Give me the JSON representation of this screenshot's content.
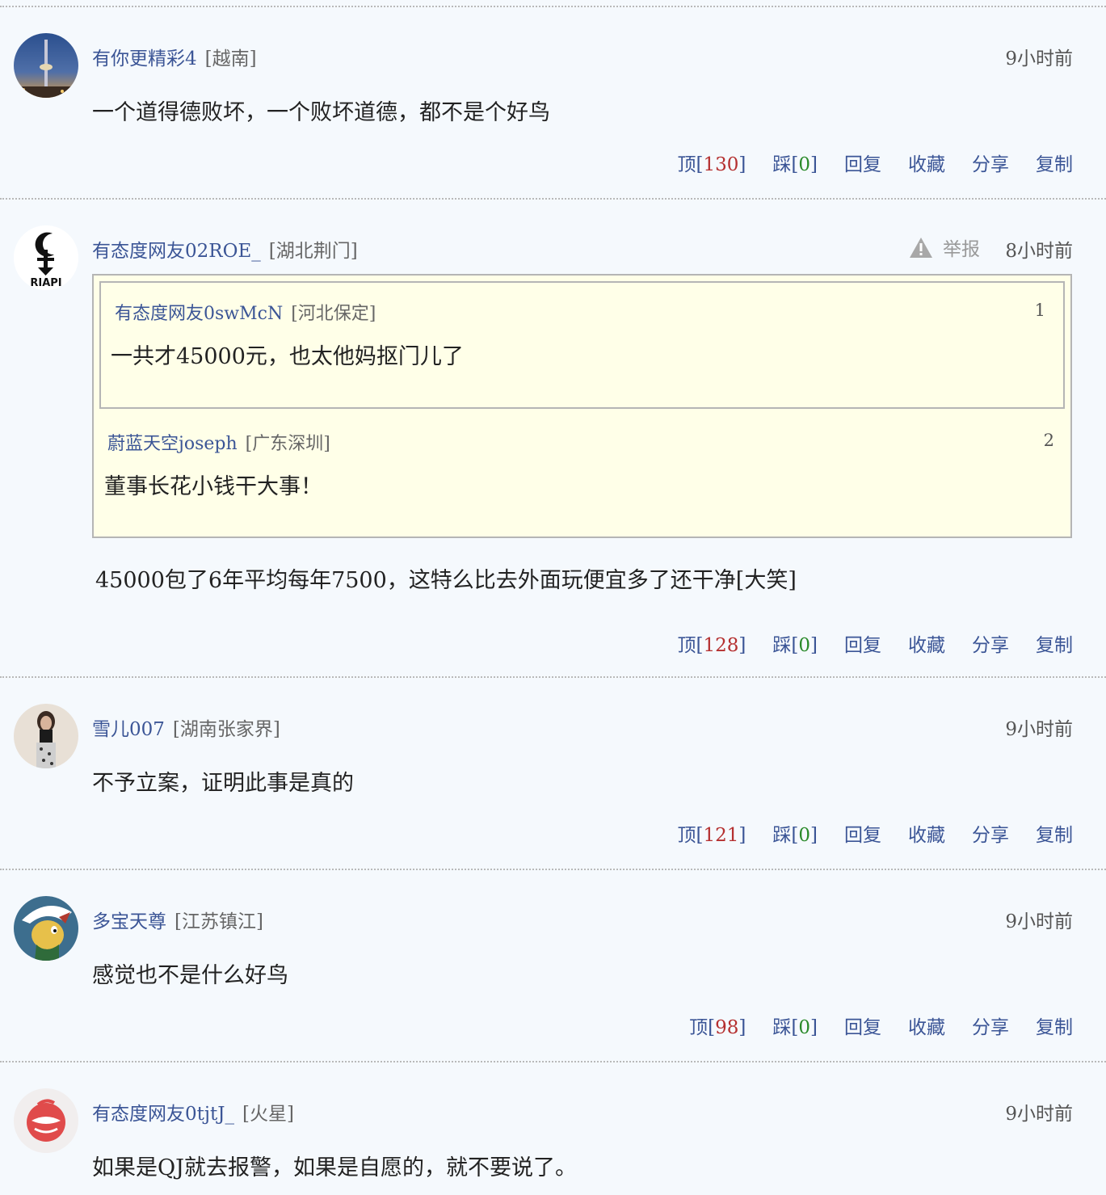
{
  "comments": [
    {
      "user": "有你更精彩4",
      "location": "[越南]",
      "time": "9小时前",
      "text": "一个道得德败坏，一个败坏道德，都不是个好鸟",
      "up_label": "顶",
      "up_count": "130",
      "down_label": "踩",
      "down_count": "0",
      "reply": "回复",
      "collect": "收藏",
      "share": "分享",
      "copy": "复制"
    },
    {
      "user": "有态度网友02ROE_",
      "location": "[湖北荆门]",
      "report": "举报",
      "time": "8小时前",
      "quotes": [
        {
          "user": "有态度网友0swMcN",
          "location": "[河北保定]",
          "floor": "1",
          "text": "一共才45000元，也太他妈抠门儿了"
        },
        {
          "user": "蔚蓝天空joseph",
          "location": "[广东深圳]",
          "floor": "2",
          "text": "董事长花小钱干大事！"
        }
      ],
      "text": "45000包了6年平均每年7500，这特么比去外面玩便宜多了还干净[大笑]",
      "up_label": "顶",
      "up_count": "128",
      "down_label": "踩",
      "down_count": "0",
      "reply": "回复",
      "collect": "收藏",
      "share": "分享",
      "copy": "复制"
    },
    {
      "user": "雪儿007",
      "location": "[湖南张家界]",
      "time": "9小时前",
      "text": "不予立案，证明此事是真的",
      "up_label": "顶",
      "up_count": "121",
      "down_label": "踩",
      "down_count": "0",
      "reply": "回复",
      "collect": "收藏",
      "share": "分享",
      "copy": "复制"
    },
    {
      "user": "多宝天尊",
      "location": "[江苏镇江]",
      "time": "9小时前",
      "text": "感觉也不是什么好鸟",
      "up_label": "顶",
      "up_count": "98",
      "down_label": "踩",
      "down_count": "0",
      "reply": "回复",
      "collect": "收藏",
      "share": "分享",
      "copy": "复制"
    },
    {
      "user": "有态度网友0tjtJ_",
      "location": "[火星]",
      "time": "9小时前",
      "text": "如果是QJ就去报警，如果是自愿的，就不要说了。"
    }
  ],
  "avatars": [
    "tower-photo-avatar",
    "riapi-logo-avatar",
    "girl-photo-avatar",
    "cartoon-dog-avatar",
    "red-cup-avatar"
  ],
  "avatar_logo_text": "RIAPI",
  "colors": {
    "username": "#3b5596",
    "up_count": "#b53030",
    "down_count": "#2a8a2a",
    "quote_bg": "#ffffe8",
    "page_bg": "#f5f9fd"
  }
}
